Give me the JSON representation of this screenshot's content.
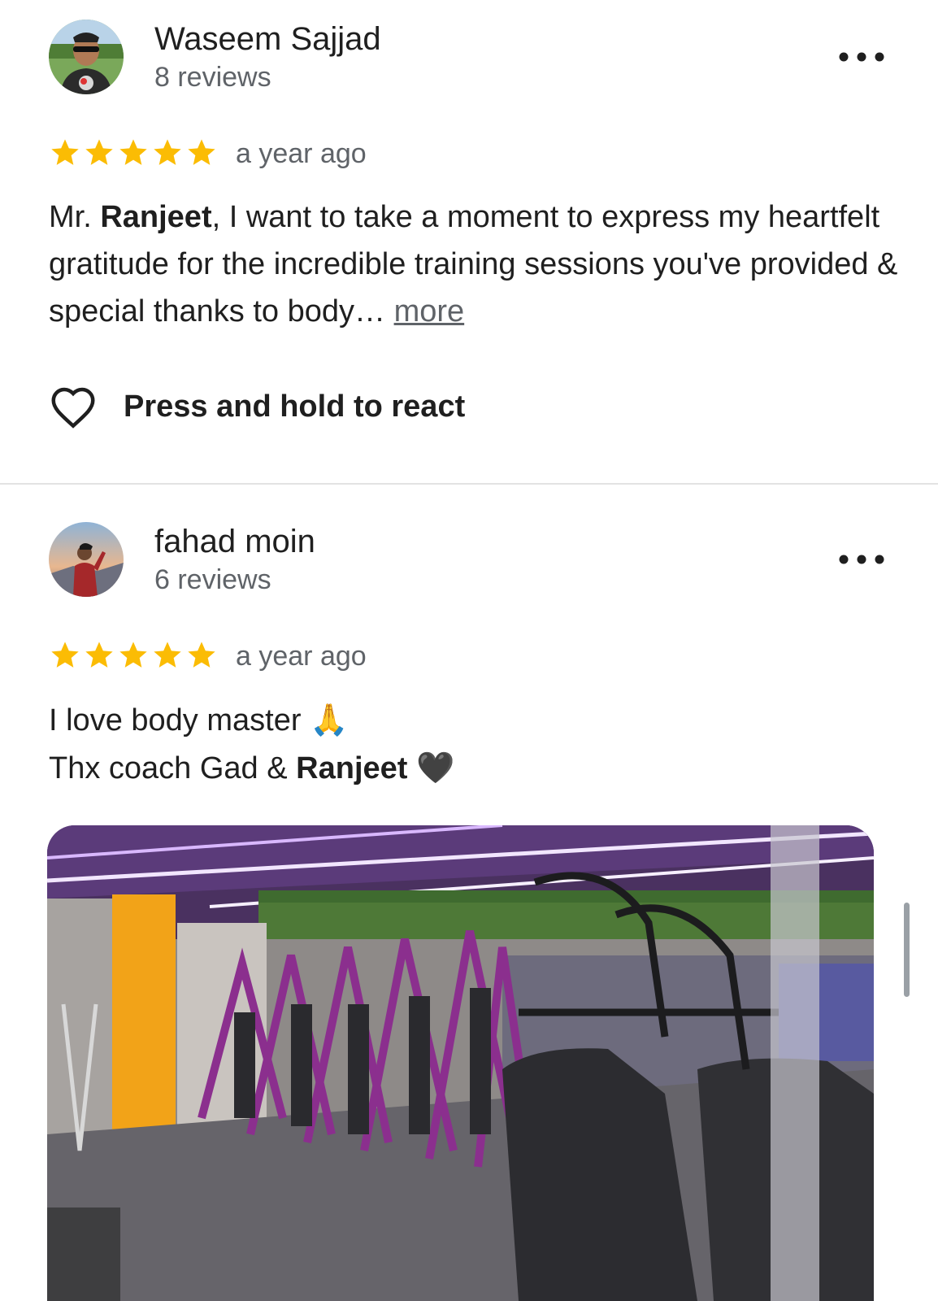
{
  "reviews": [
    {
      "reviewer_name": "Waseem Sajjad",
      "review_count": "8 reviews",
      "rating": 5,
      "time": "a year ago",
      "text_prefix": "Mr. ",
      "text_bold": "Ranjeet",
      "text_rest": ",  I want to take a moment to express my heartfelt gratitude for the incredible training sessions you've provided & special thanks to body…",
      "more_label": "more",
      "react_label": "Press and hold to react"
    },
    {
      "reviewer_name": "fahad moin",
      "review_count": "6 reviews",
      "rating": 5,
      "time": "a year ago",
      "line1": "I love body master",
      "line1_emoji": "🙏",
      "line2_prefix": "Thx coach Gad & ",
      "line2_bold": "Ranjeet",
      "line2_emoji": "🖤"
    }
  ],
  "icons": {
    "star": "star-icon",
    "heart": "heart-outline-icon",
    "menu": "more-options-icon"
  },
  "colors": {
    "star": "#fbbc04",
    "secondary_text": "#5f6368",
    "divider": "#e3e3e3"
  }
}
